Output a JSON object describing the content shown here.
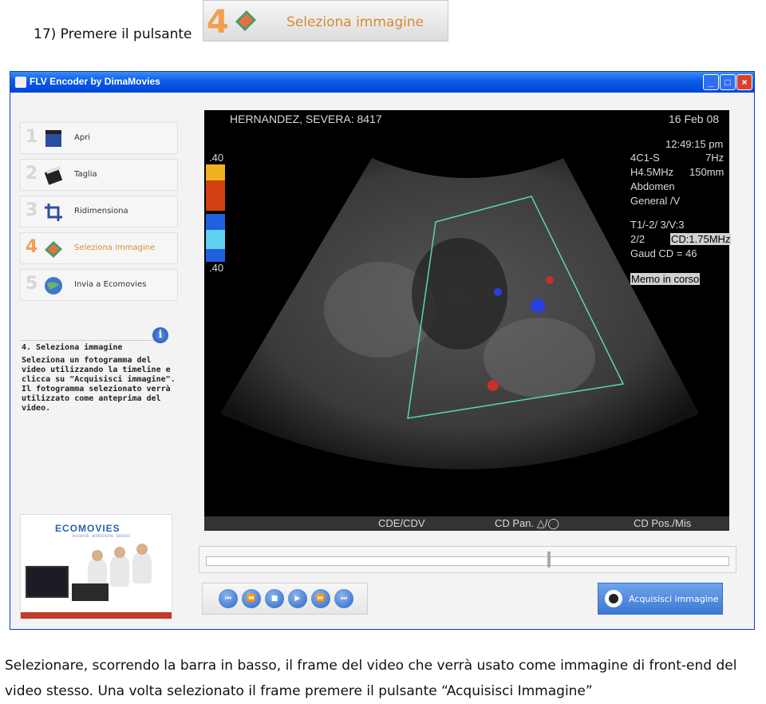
{
  "instruction_top": {
    "text": "17) Premere il pulsante",
    "button_number": "4",
    "button_label": "Seleziona immagine"
  },
  "window": {
    "title": "FLV Encoder by DimaMovies",
    "controls": [
      "_",
      "□",
      "×"
    ]
  },
  "nav": {
    "items": [
      {
        "number": "1",
        "label": "Apri",
        "icon": "film-clapper-icon"
      },
      {
        "number": "2",
        "label": "Taglia",
        "icon": "scissors-clapper-icon"
      },
      {
        "number": "3",
        "label": "Ridimensiona",
        "icon": "crop-icon"
      },
      {
        "number": "4",
        "label": "Seleziona immagine",
        "icon": "image-select-icon",
        "active": true
      },
      {
        "number": "5",
        "label": "Invia a Ecomovies",
        "icon": "globe-icon"
      }
    ]
  },
  "help": {
    "icon": "info-icon",
    "title": "4. Seleziona immagine",
    "body": "Seleziona un fotogramma del\nvideo utilizzando la timeline e\nclicca su \"Acquisisci immagine\".\nIl fotogramma selezionato verrà\nutilizzato come anteprima del\nvideo."
  },
  "ad": {
    "logo": "ECOMOVIES",
    "tagline": "Accendi, ambizione, lavora!"
  },
  "ultrasound": {
    "patient": "HERNANDEZ, SEVERA: 8417",
    "date": "16 Feb 08",
    "time": "12:49:15 pm",
    "scale_top": ".40",
    "scale_bottom": ".40",
    "params": [
      "4C1-S",
      "7Hz",
      "H4.5MHz",
      "150mm",
      "Abdomen",
      "General /V"
    ],
    "params2": [
      "T1/-2/ 3/V:3",
      "2/2",
      "CD:1.75MHz",
      "Gaud CD = 46"
    ],
    "memo": "Memo in corso",
    "bottom_left": "CDE/CDV",
    "bottom_mid": "CD Pan. △/◯",
    "bottom_right": "CD Pos./Mis"
  },
  "playback": {
    "buttons": [
      "first-frame-icon",
      "rewind-icon",
      "stop-icon",
      "play-icon",
      "fast-forward-icon",
      "last-frame-icon"
    ],
    "glyphs": [
      "⏮",
      "⏪",
      "■",
      "▶",
      "⏩",
      "⏭"
    ]
  },
  "acquire_button": {
    "label": "Acquisisci immagine",
    "icon": "camera-icon"
  },
  "timeline_position": 0.655,
  "instruction_bottom": "Selezionare, scorrendo la barra in basso, il frame del video che verrà usato come immagine di front-end del video stesso. Una volta selezionato il frame premere il pulsante “Acquisisci Immagine”"
}
